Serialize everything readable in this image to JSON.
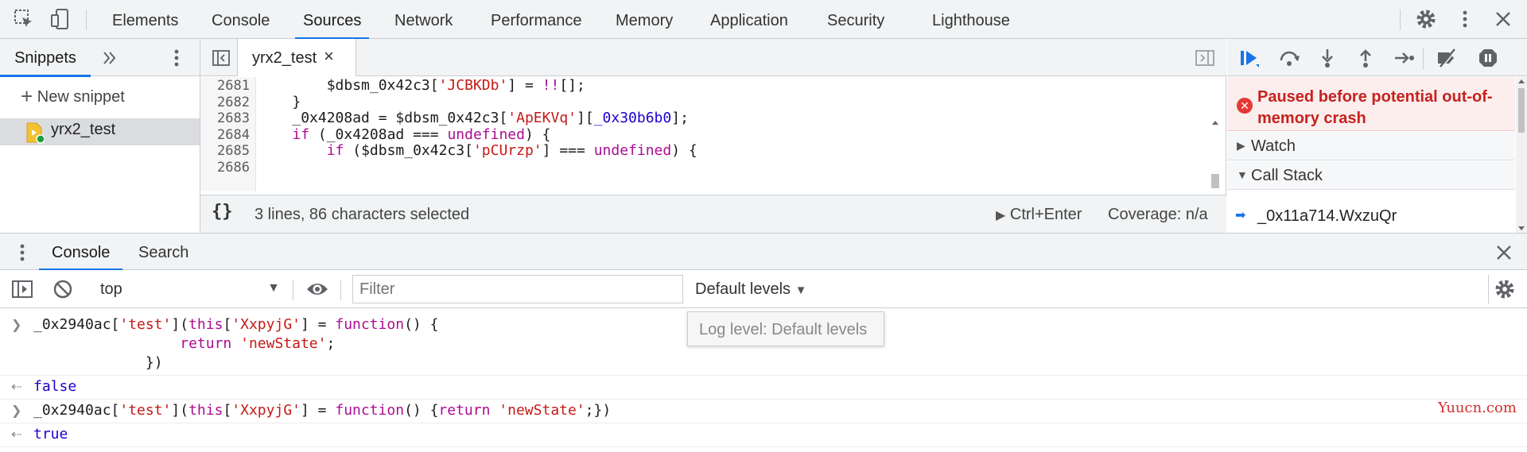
{
  "toolbar": {
    "tabs": [
      "Elements",
      "Console",
      "Sources",
      "Network",
      "Performance",
      "Memory",
      "Application",
      "Security",
      "Lighthouse"
    ],
    "active_tab": "Sources"
  },
  "navigator": {
    "tab": "Snippets",
    "new_snippet": "New snippet",
    "item": "yrx2_test"
  },
  "editor": {
    "file_tab": "yrx2_test",
    "close_glyph": "×",
    "lines": [
      {
        "n": "2681",
        "indent": "        ",
        "parts": [
          [
            "t",
            "$dbsm_0x42c3["
          ],
          [
            "s",
            "'JCBKDb'"
          ],
          [
            "t",
            "] = "
          ],
          [
            "k",
            "!!"
          ],
          [
            "t",
            "[];"
          ]
        ]
      },
      {
        "n": "2682",
        "indent": "    ",
        "parts": [
          [
            "t",
            "}"
          ]
        ]
      },
      {
        "n": "2683",
        "indent": "    ",
        "parts": [
          [
            "t",
            "_0x4208ad = $dbsm_0x42c3["
          ],
          [
            "s",
            "'ApEKVq'"
          ],
          [
            "t",
            "]["
          ],
          [
            "n",
            "_0x30b6b0"
          ],
          [
            "t",
            "];"
          ]
        ]
      },
      {
        "n": "2684",
        "indent": "    ",
        "parts": [
          [
            "k",
            "if"
          ],
          [
            "t",
            " (_0x4208ad === "
          ],
          [
            "k",
            "undefined"
          ],
          [
            "t",
            ") {"
          ]
        ]
      },
      {
        "n": "2685",
        "indent": "        ",
        "parts": [
          [
            "k",
            "if"
          ],
          [
            "t",
            " ($dbsm_0x42c3["
          ],
          [
            "s",
            "'pCUrzp'"
          ],
          [
            "t",
            "] === "
          ],
          [
            "k",
            "undefined"
          ],
          [
            "t",
            ") {"
          ]
        ]
      },
      {
        "n": "2686",
        "indent": "            ",
        "parts": [
          [
            "t",
            "    "
          ]
        ]
      }
    ],
    "status": {
      "pretty_print": "{}",
      "selection": "3 lines, 86 characters selected",
      "run": "Ctrl+Enter",
      "coverage": "Coverage: n/a"
    }
  },
  "debugger": {
    "paused_message": "Paused before potential out-of-memory crash",
    "watch": "Watch",
    "call_stack": "Call Stack",
    "frame": "_0x11a714.WxzuQr"
  },
  "drawer": {
    "tabs": [
      "Console",
      "Search"
    ],
    "active_tab": "Console",
    "context": "top",
    "filter_placeholder": "Filter",
    "levels": "Default levels",
    "tooltip": "Log level: Default levels"
  },
  "console": {
    "messages": [
      {
        "type": "input",
        "lines": [
          [
            [
              "t",
              "_0x2940ac["
            ],
            [
              "s",
              "'test'"
            ],
            [
              "t",
              "]("
            ],
            [
              "k",
              "this"
            ],
            [
              "t",
              "["
            ],
            [
              "s",
              "'XxpyjG'"
            ],
            [
              "t",
              "] = "
            ],
            [
              "k",
              "function"
            ],
            [
              "t",
              "() {"
            ]
          ],
          [
            [
              "t",
              "                 "
            ],
            [
              "k",
              "return"
            ],
            [
              "t",
              " "
            ],
            [
              "s",
              "'newState'"
            ],
            [
              "t",
              ";"
            ]
          ],
          [
            [
              "t",
              "             })"
            ]
          ]
        ]
      },
      {
        "type": "result",
        "value": "false"
      },
      {
        "type": "input",
        "lines": [
          [
            [
              "t",
              "_0x2940ac["
            ],
            [
              "s",
              "'test'"
            ],
            [
              "t",
              "]("
            ],
            [
              "k",
              "this"
            ],
            [
              "t",
              "["
            ],
            [
              "s",
              "'XxpyjG'"
            ],
            [
              "t",
              "] = "
            ],
            [
              "k",
              "function"
            ],
            [
              "t",
              "() {"
            ],
            [
              "k",
              "return"
            ],
            [
              "t",
              " "
            ],
            [
              "s",
              "'newState'"
            ],
            [
              "t",
              ";})"
            ]
          ]
        ]
      },
      {
        "type": "result",
        "value": "true"
      }
    ]
  },
  "watermark": "Yuucn.com",
  "colors": {
    "accent": "#1a73e8",
    "string": "#c41a16",
    "keyword": "#aa0d91",
    "error": "#c5221f"
  }
}
